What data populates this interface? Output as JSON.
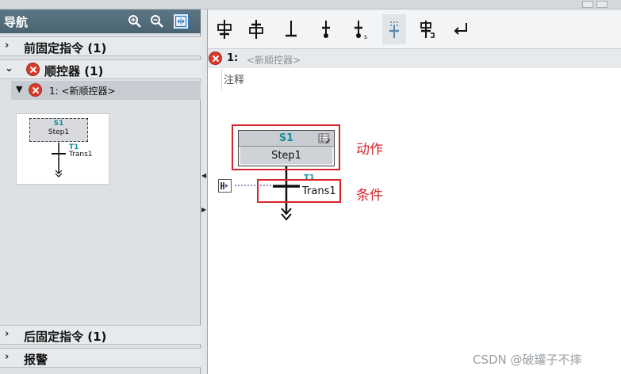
{
  "nav": {
    "title": "导航",
    "sections": [
      {
        "label": "前固定指令 (1)",
        "caret": "›"
      },
      {
        "label": "顺控器 (1)",
        "caret": "⌄"
      },
      {
        "label": "后固定指令 (1)",
        "caret": "›"
      },
      {
        "label": "报警",
        "caret": "›"
      }
    ],
    "sequence_item": {
      "label": "1: <新顺控器>",
      "triangle": "▼"
    },
    "thumbnail": {
      "step_number": "S1",
      "step_name": "Step1",
      "trans_number": "T1",
      "trans_name": "Trans1"
    }
  },
  "editor": {
    "sequence_number": "1:",
    "sequence_name": "<新顺控器>",
    "comment": "注释",
    "step": {
      "number": "S1",
      "name": "Step1"
    },
    "transition": {
      "number": "T1",
      "name": "Trans1"
    }
  },
  "annotations": {
    "action": "动作",
    "condition": "条件"
  },
  "watermark": "CSDN @破罐子不摔",
  "colors": {
    "annotation": "#d6262c",
    "step_number": "#1a8f9a",
    "nav_header": "#4a6371",
    "error": "#d83a2b"
  }
}
